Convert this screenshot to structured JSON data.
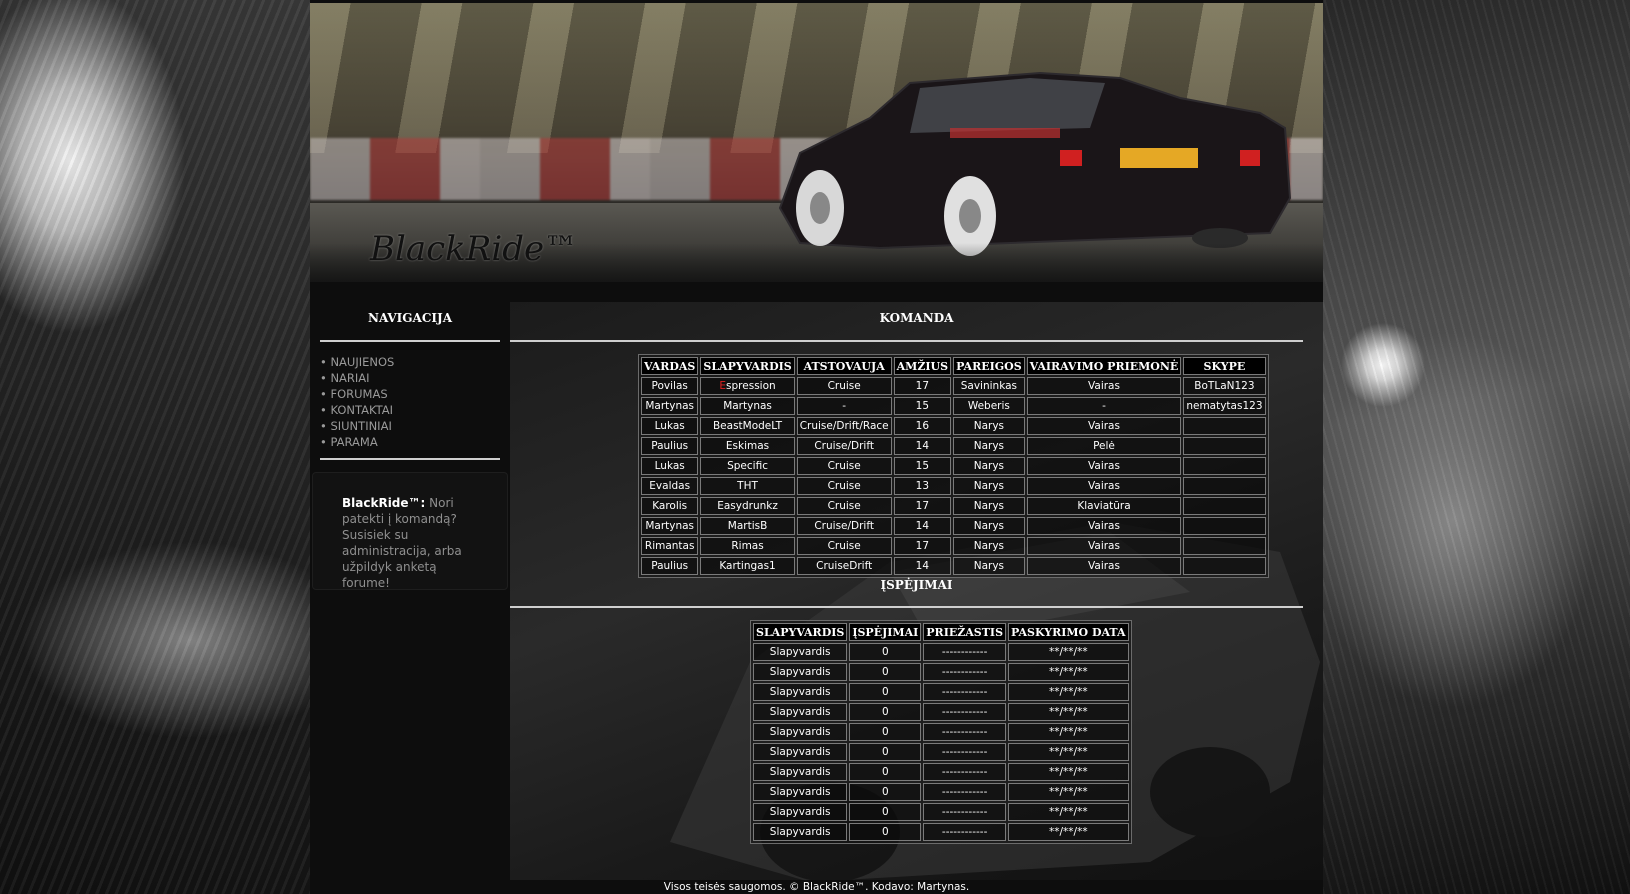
{
  "site": {
    "logo_text": "BlackRide™"
  },
  "nav": {
    "title": "NAVIGACIJA",
    "bullet": "•",
    "items": [
      {
        "label": "NAUJIENOS"
      },
      {
        "label": "NARIAI"
      },
      {
        "label": "FORUMAS"
      },
      {
        "label": "KONTAKTAI"
      },
      {
        "label": "SIUNTINIAI"
      },
      {
        "label": "PARAMA"
      }
    ]
  },
  "info": {
    "brand": "BlackRide™:",
    "text": "Nori patekti į komandą? Susisiek su administracija, arba užpildyk anketą forume!"
  },
  "team": {
    "title": "KOMANDA",
    "headers": [
      "VARDAS",
      "SLAPYVARDIS",
      "ATSTOVAUJA",
      "AMŽIUS",
      "PAREIGOS",
      "VAIRAVIMO PRIEMONĖ",
      "SKYPE"
    ],
    "rows": [
      [
        "Povilas",
        "Espression",
        "Cruise",
        "17",
        "Savininkas",
        "Vairas",
        "BoTLaN123"
      ],
      [
        "Martynas",
        "Martynas",
        "-",
        "15",
        "Weberis",
        "-",
        "nematytas123"
      ],
      [
        "Lukas",
        "BeastModeLT",
        "Cruise/Drift/Race",
        "16",
        "Narys",
        "Vairas",
        ""
      ],
      [
        "Paulius",
        "Eskimas",
        "Cruise/Drift",
        "14",
        "Narys",
        "Pelė",
        ""
      ],
      [
        "Lukas",
        "Specific",
        "Cruise",
        "15",
        "Narys",
        "Vairas",
        ""
      ],
      [
        "Evaldas",
        "THT",
        "Cruise",
        "13",
        "Narys",
        "Vairas",
        ""
      ],
      [
        "Karolis",
        "Easydrunkz",
        "Cruise",
        "17",
        "Narys",
        "Klaviatūra",
        ""
      ],
      [
        "Martynas",
        "MartisB",
        "Cruise/Drift",
        "14",
        "Narys",
        "Vairas",
        ""
      ],
      [
        "Rimantas",
        "Rimas",
        "Cruise",
        "17",
        "Narys",
        "Vairas",
        ""
      ],
      [
        "Paulius",
        "Kartingas1",
        "CruiseDrift",
        "14",
        "Narys",
        "Vairas",
        ""
      ]
    ],
    "highlight_color": "#e02020"
  },
  "warnings": {
    "title": "ĮSPĖJIMAI",
    "headers": [
      "SLAPYVARDIS",
      "ĮSPĖJIMAI",
      "PRIEŽASTIS",
      "PASKYRIMO DATA"
    ],
    "rows": [
      [
        "Slapyvardis",
        "0",
        "------------",
        "**/**/**"
      ],
      [
        "Slapyvardis",
        "0",
        "------------",
        "**/**/**"
      ],
      [
        "Slapyvardis",
        "0",
        "------------",
        "**/**/**"
      ],
      [
        "Slapyvardis",
        "0",
        "------------",
        "**/**/**"
      ],
      [
        "Slapyvardis",
        "0",
        "------------",
        "**/**/**"
      ],
      [
        "Slapyvardis",
        "0",
        "------------",
        "**/**/**"
      ],
      [
        "Slapyvardis",
        "0",
        "------------",
        "**/**/**"
      ],
      [
        "Slapyvardis",
        "0",
        "------------",
        "**/**/**"
      ],
      [
        "Slapyvardis",
        "0",
        "------------",
        "**/**/**"
      ],
      [
        "Slapyvardis",
        "0",
        "------------",
        "**/**/**"
      ]
    ]
  },
  "footer": {
    "text": "Visos teisės saugomos. © BlackRide™. Kodavo: Martynas."
  }
}
